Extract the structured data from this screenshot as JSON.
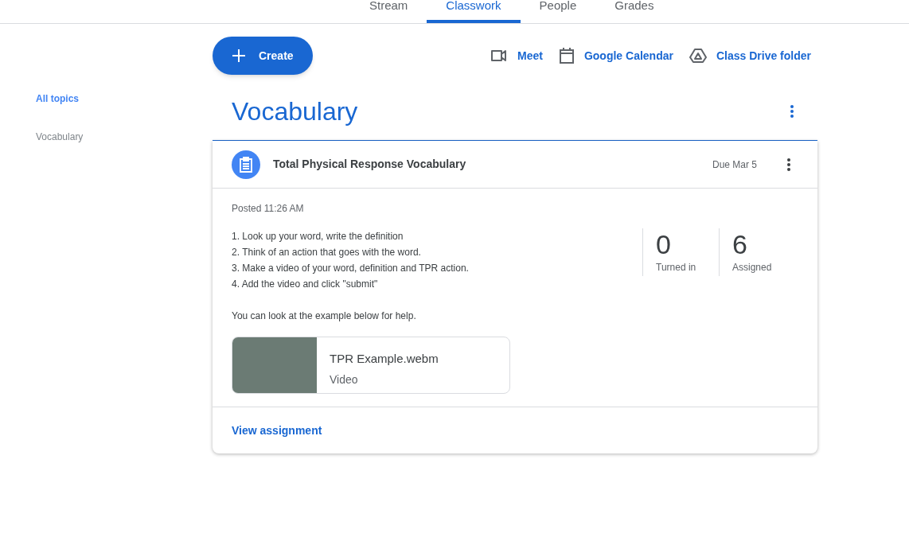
{
  "tabs": [
    {
      "label": "Stream",
      "selected": false
    },
    {
      "label": "Classwork",
      "selected": true
    },
    {
      "label": "People",
      "selected": false
    },
    {
      "label": "Grades",
      "selected": false
    }
  ],
  "create_button": {
    "label": "Create"
  },
  "links": [
    {
      "kind": "meet",
      "label": "Meet"
    },
    {
      "kind": "calendar",
      "label": "Google Calendar"
    },
    {
      "kind": "drive",
      "label": "Class Drive folder"
    }
  ],
  "sidebar": {
    "items": [
      {
        "label": "All topics",
        "selected": true
      },
      {
        "label": "Vocabulary",
        "selected": false
      }
    ]
  },
  "topic": {
    "title": "Vocabulary"
  },
  "assignment": {
    "title": "Total Physical Response Vocabulary",
    "due": "Due Mar 5",
    "posted": "Posted 11:26 AM",
    "instructions": [
      "1. Look up your word, write the definition",
      "2. Think of an action that goes with the word.",
      "3. Make a video of your word, definition and TPR action.",
      "4. Add the video and click \"submit\""
    ],
    "note": "You can look at the example below for help.",
    "stats": [
      {
        "value": "0",
        "label": "Turned in"
      },
      {
        "value": "6",
        "label": "Assigned"
      }
    ],
    "attachment": {
      "name": "TPR Example.webm",
      "type": "Video"
    },
    "view_link": "View assignment"
  }
}
